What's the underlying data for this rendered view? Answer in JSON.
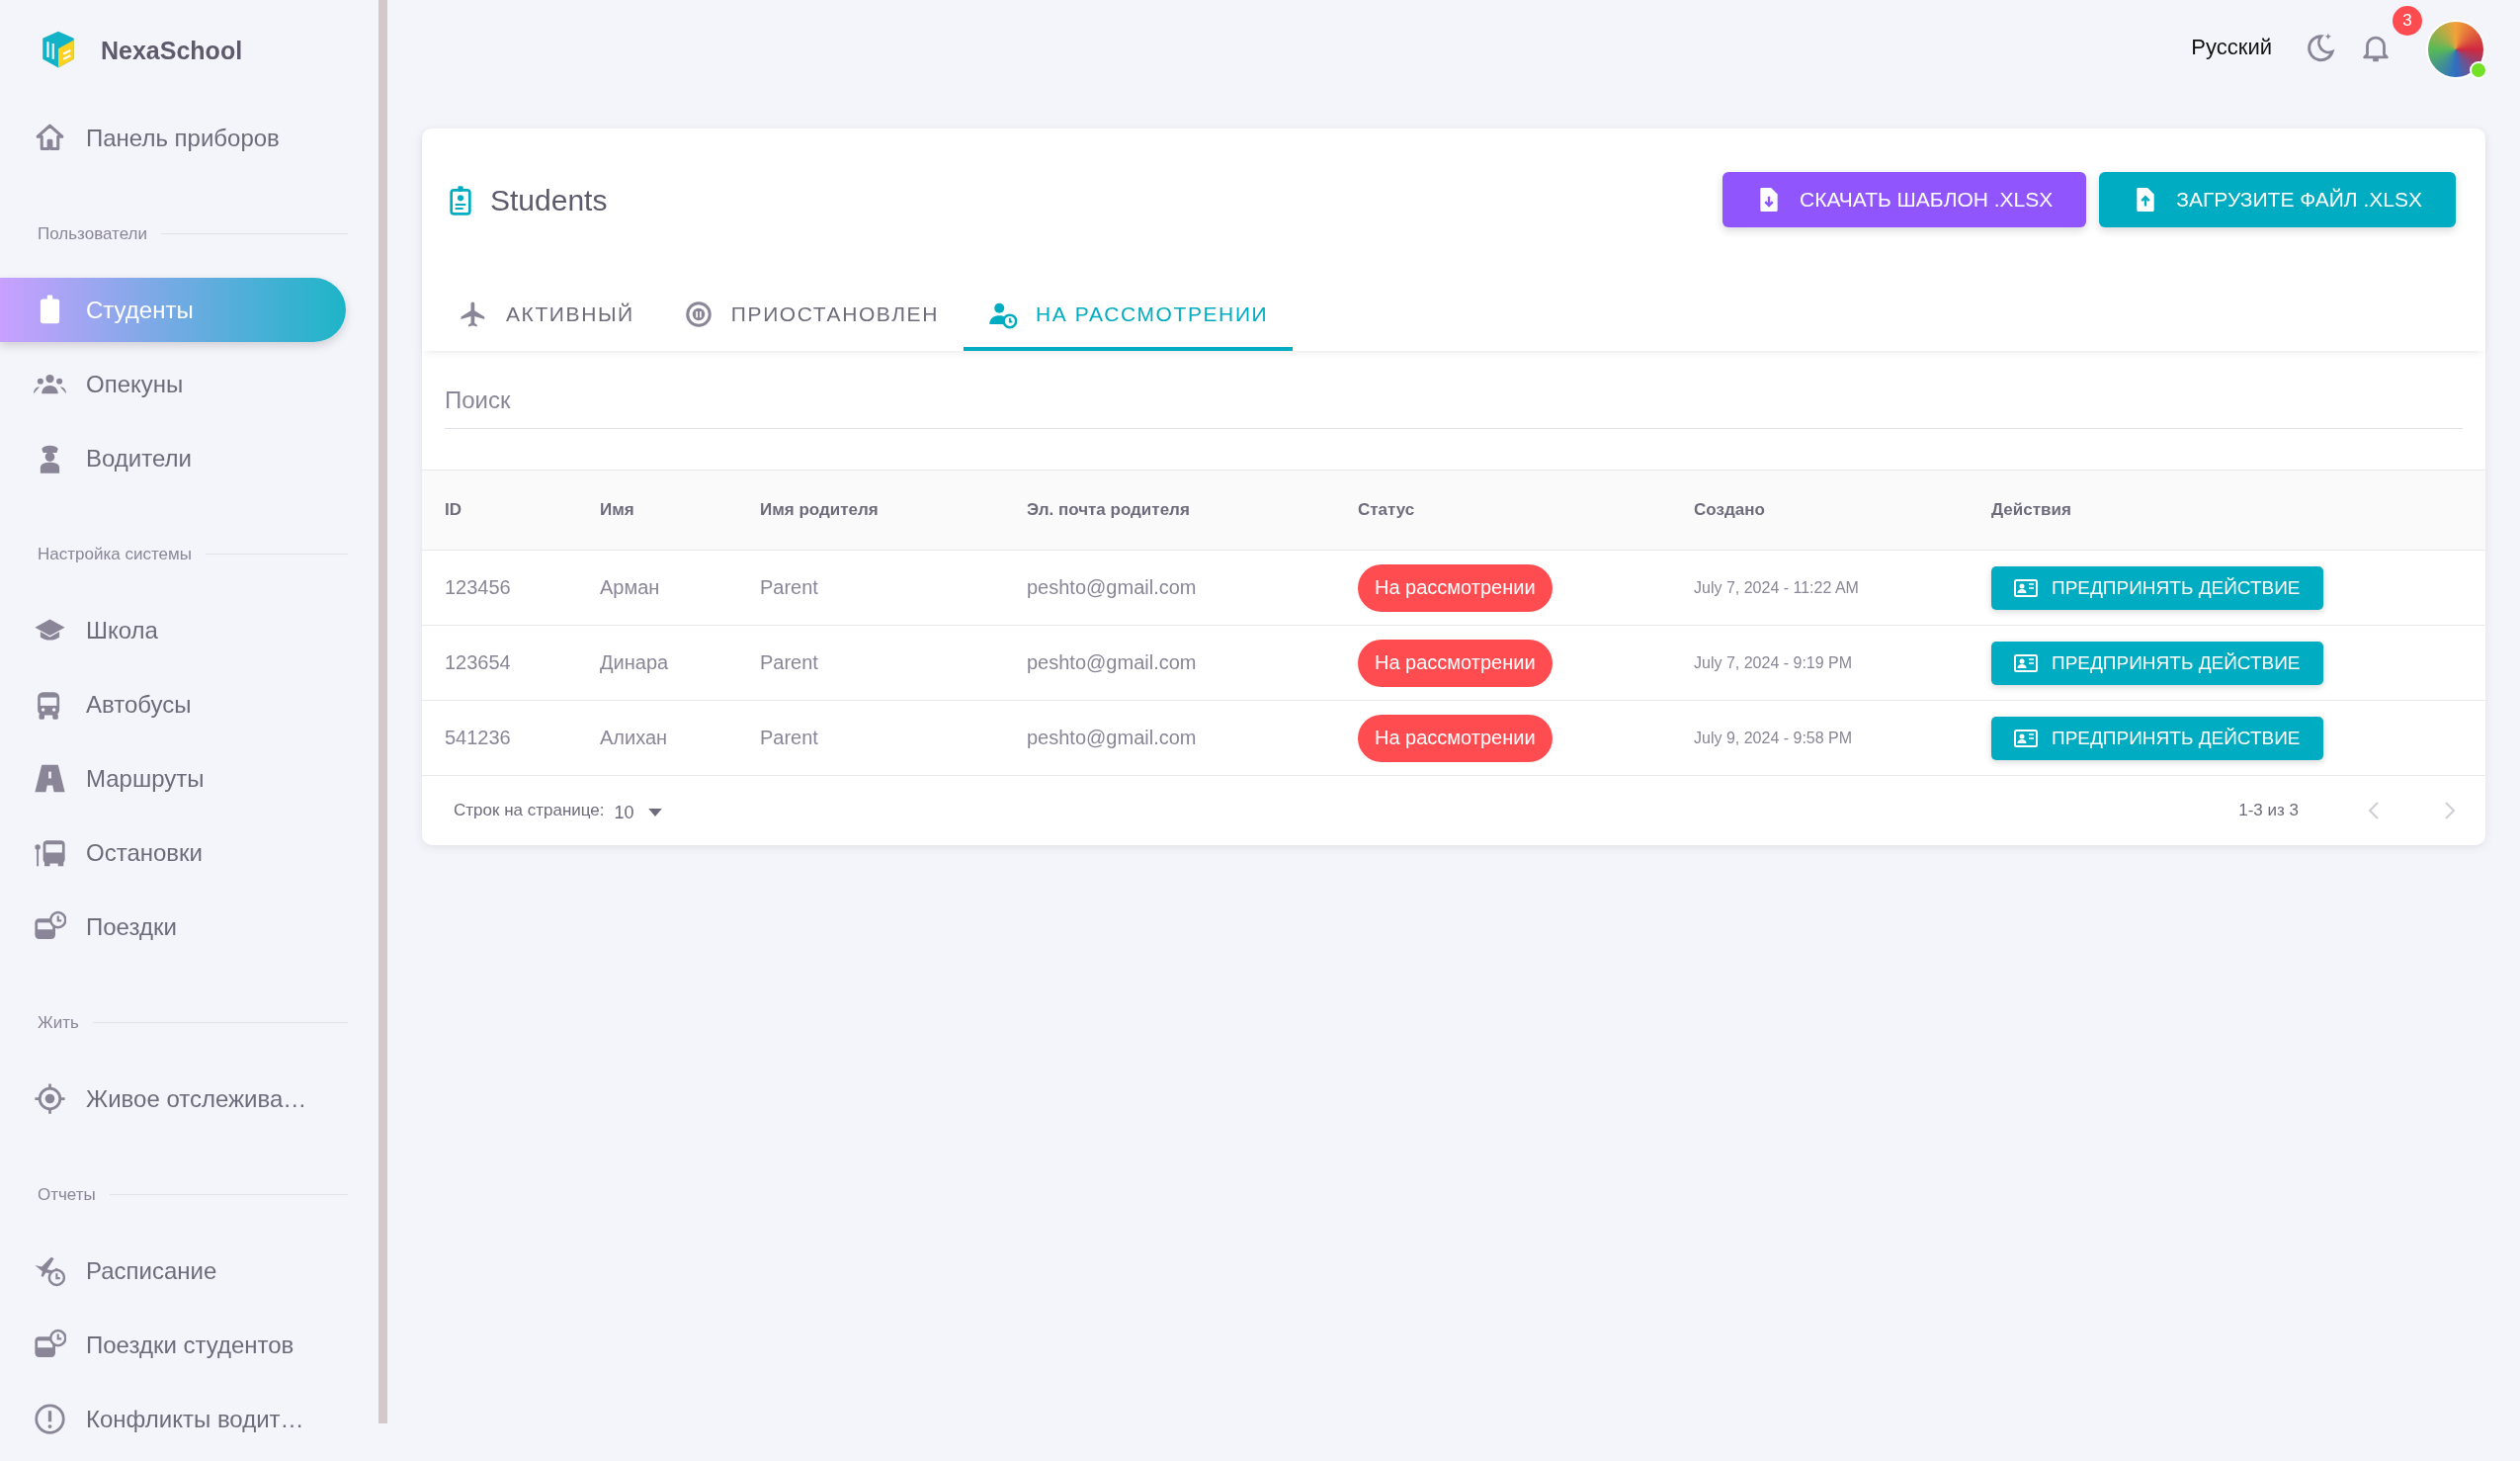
{
  "brand": {
    "name": "NexaSchool"
  },
  "sidebar": {
    "items": [
      {
        "kind": "link",
        "label": "Панель приборов",
        "selected": false
      },
      {
        "kind": "section",
        "label": "Пользователи"
      },
      {
        "kind": "link",
        "label": "Студенты",
        "selected": true
      },
      {
        "kind": "link",
        "label": "Опекуны",
        "selected": false
      },
      {
        "kind": "link",
        "label": "Водители",
        "selected": false
      },
      {
        "kind": "section",
        "label": "Настройка системы"
      },
      {
        "kind": "link",
        "label": "Школа",
        "selected": false
      },
      {
        "kind": "link",
        "label": "Автобусы",
        "selected": false
      },
      {
        "kind": "link",
        "label": "Маршруты",
        "selected": false
      },
      {
        "kind": "link",
        "label": "Остановки",
        "selected": false
      },
      {
        "kind": "link",
        "label": "Поездки",
        "selected": false
      },
      {
        "kind": "section",
        "label": "Жить"
      },
      {
        "kind": "link",
        "label": "Живое отслежива…",
        "selected": false
      },
      {
        "kind": "section",
        "label": "Отчеты"
      },
      {
        "kind": "link",
        "label": "Расписание",
        "selected": false
      },
      {
        "kind": "link",
        "label": "Поездки студентов",
        "selected": false
      },
      {
        "kind": "link",
        "label": "Конфликты водит…",
        "selected": false
      }
    ]
  },
  "topbar": {
    "language": "Русский",
    "notifications": "3"
  },
  "page": {
    "title": "Students",
    "buttons": [
      {
        "kind": "download",
        "label": "СКАЧАТЬ ШАБЛОН .XLSX"
      },
      {
        "kind": "upload",
        "label": "ЗАГРУЗИТЕ ФАЙЛ .XLSX"
      }
    ]
  },
  "tabs": [
    {
      "label": "АКТИВНЫЙ",
      "selected": false
    },
    {
      "label": "ПРИОСТАНОВЛЕН",
      "selected": false
    },
    {
      "label": "НА РАССМОТРЕНИИ",
      "selected": true
    }
  ],
  "search": {
    "placeholder": "Поиск"
  },
  "table": {
    "columns": [
      "ID",
      "Имя",
      "Имя родителя",
      "Эл. почта родителя",
      "Статус",
      "Создано",
      "Действия"
    ],
    "rows": [
      {
        "id": "123456",
        "name": "Арман",
        "parent_name": "Parent",
        "parent_email": "peshto@gmail.com",
        "status": "На рассмотрении",
        "created": "July 7, 2024 - 11:22 AM",
        "action": "ПРЕДПРИНЯТЬ ДЕЙСТВИЕ"
      },
      {
        "id": "123654",
        "name": "Динара",
        "parent_name": "Parent",
        "parent_email": "peshto@gmail.com",
        "status": "На рассмотрении",
        "created": "July 7, 2024 - 9:19 PM",
        "action": "ПРЕДПРИНЯТЬ ДЕЙСТВИЕ"
      },
      {
        "id": "541236",
        "name": "Алихан",
        "parent_name": "Parent",
        "parent_email": "peshto@gmail.com",
        "status": "На рассмотрении",
        "created": "July 9, 2024 - 9:58 PM",
        "action": "ПРЕДПРИНЯТЬ ДЕЙСТВИЕ"
      }
    ]
  },
  "pagination": {
    "rows_per_page_label": "Строк на странице:",
    "rows_per_page": "10",
    "range": "1-3 из 3"
  }
}
